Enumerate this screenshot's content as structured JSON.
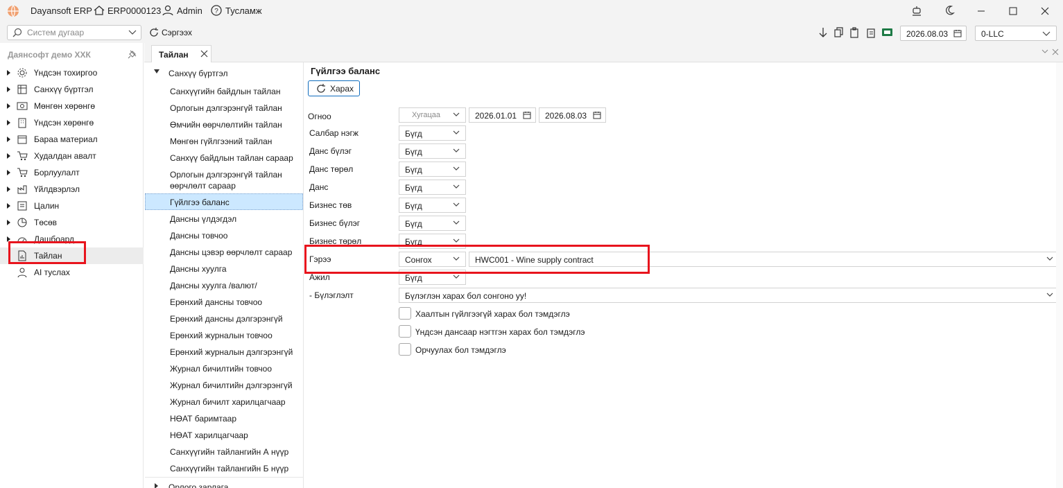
{
  "titlebar": {
    "app_name": "Dayansoft ERP",
    "db_code": "ERP0000123",
    "user": "Admin",
    "help": "Тусламж"
  },
  "toolbar": {
    "system_search_placeholder": "Систем дугаар",
    "refresh_label": "Сэргээх",
    "date": "2026.08.03",
    "company_code": "0-LLC"
  },
  "sidebar": {
    "company": "Даянсофт демо ХХК",
    "items": [
      {
        "label": "Үндсэн тохиргоо",
        "icon": "gear-icon"
      },
      {
        "label": "Санхүү бүртгэл",
        "icon": "ledger-icon"
      },
      {
        "label": "Мөнгөн хөрөнгө",
        "icon": "money-icon"
      },
      {
        "label": "Үндсэн хөрөнгө",
        "icon": "building-icon"
      },
      {
        "label": "Бараа материал",
        "icon": "box-icon"
      },
      {
        "label": "Худалдан авалт",
        "icon": "cart-icon"
      },
      {
        "label": "Борлуулалт",
        "icon": "sales-icon"
      },
      {
        "label": "Үйлдвэрлэл",
        "icon": "factory-icon"
      },
      {
        "label": "Цалин",
        "icon": "salary-icon"
      },
      {
        "label": "Төсөв",
        "icon": "pie-chart-icon"
      },
      {
        "label": "Дашбоард",
        "icon": "dashboard-icon"
      },
      {
        "label": "Тайлан",
        "icon": "report-icon"
      },
      {
        "label": "AI туслах",
        "icon": "assistant-icon"
      }
    ]
  },
  "tab": {
    "label": "Тайлан"
  },
  "report_tree": {
    "group": "Санхүү бүртгэл",
    "items": [
      "Санхүүгийн байдлын тайлан",
      "Орлогын дэлгэрэнгүй тайлан",
      "Өмчийн өөрчлөлтийн тайлан",
      "Мөнгөн гүйлгээний тайлан",
      "Санхүү байдлын тайлан сараар",
      "Орлогын дэлгэрэнгүй тайлан",
      "Гүйлгээ баланс",
      "Дансны үлдэгдэл",
      "Дансны товчоо",
      "Дансны цэвэр өөрчлөлт сараар",
      "Дансны хуулга",
      "Дансны хуулга /валют/",
      "Ерөнхий дансны товчоо",
      "Ерөнхий дансны дэлгэрэнгүй",
      "Ерөнхий журналын товчоо",
      "Ерөнхий журналын дэлгэрэнгүй",
      "Журнал бичилтийн товчоо",
      "Журнал бичилтийн дэлгэрэнгүй",
      "Журнал бичилт харилцагчаар",
      "НӨАТ баримтаар",
      "НӨАТ харилцагчаар",
      "Санхүүгийн тайлангийн А нүүр",
      "Санхүүгийн тайлангийн Б нүүр"
    ],
    "item6_line2": "өөрчлөлт сараар",
    "next_group": "Орлого зарлага"
  },
  "form": {
    "title": "Гүйлгээ баланс",
    "view_button": "Харах",
    "date_label": "Огноо",
    "period_select": "Хугацаа",
    "date_from": "2026.01.01",
    "date_to": "2026.08.03",
    "fields": [
      {
        "label": "Салбар нэгж",
        "value": "Бүгд"
      },
      {
        "label": "Данс бүлэг",
        "value": "Бүгд"
      },
      {
        "label": "Данс төрөл",
        "value": "Бүгд"
      },
      {
        "label": "Данс",
        "value": "Бүгд"
      },
      {
        "label": "Бизнес төв",
        "value": "Бүгд"
      },
      {
        "label": "Бизнес бүлэг",
        "value": "Бүгд"
      },
      {
        "label": "Бизнес төрөл",
        "value": "Бүгд"
      }
    ],
    "contract_label": "Гэрээ",
    "contract_mode": "Сонгох",
    "contract_value": "HWC001 - Wine supply contract",
    "job_label": "Ажил",
    "job_value": "Бүгд",
    "grouping_label": "- Бүлэглэлт",
    "grouping_value": "Бүлэглэн харах бол сонгоно уу!",
    "checkboxes": [
      "Хаалтын гүйлгээгүй харах бол тэмдэглэ",
      "Үндсэн дансаар нэгтгэн харах бол тэмдэглэ",
      "Орчуулах бол тэмдэглэ"
    ]
  },
  "colors": {
    "highlight": "#e8141d",
    "selection": "#cce8ff",
    "accent": "#0f6cbd"
  }
}
